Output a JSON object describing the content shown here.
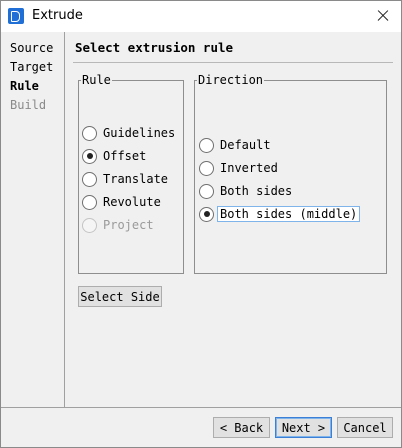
{
  "window": {
    "title": "Extrude"
  },
  "steps": [
    {
      "label": "Source",
      "state": "done"
    },
    {
      "label": "Target",
      "state": "done"
    },
    {
      "label": "Rule",
      "state": "current"
    },
    {
      "label": "Build",
      "state": "pending"
    }
  ],
  "page": {
    "title": "Select extrusion rule"
  },
  "rule_group": {
    "label": "Rule",
    "options": [
      {
        "label": "Guidelines",
        "checked": false,
        "disabled": false
      },
      {
        "label": "Offset",
        "checked": true,
        "disabled": false
      },
      {
        "label": "Translate",
        "checked": false,
        "disabled": false
      },
      {
        "label": "Revolute",
        "checked": false,
        "disabled": false
      },
      {
        "label": "Project",
        "checked": false,
        "disabled": true
      }
    ]
  },
  "direction_group": {
    "label": "Direction",
    "options": [
      {
        "label": "Default",
        "checked": false
      },
      {
        "label": "Inverted",
        "checked": false
      },
      {
        "label": "Both sides",
        "checked": false
      },
      {
        "label": "Both sides (middle)",
        "checked": true
      }
    ]
  },
  "select_side_button": "Select Side",
  "footer": {
    "back": "< Back",
    "next": "Next >",
    "cancel": "Cancel"
  }
}
